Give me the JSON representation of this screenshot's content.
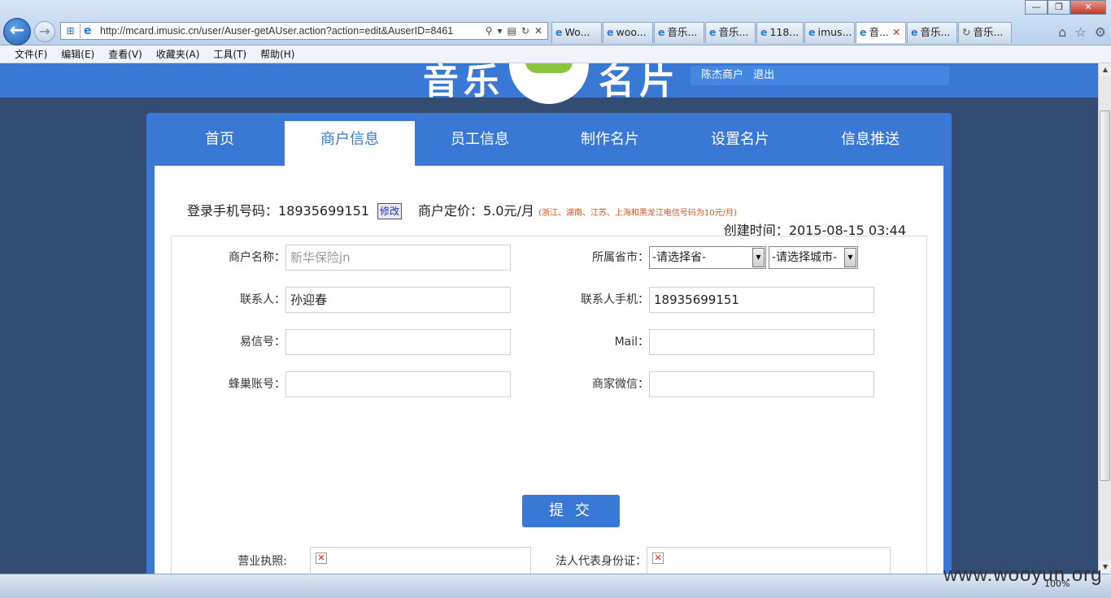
{
  "browser": {
    "url": "http://mcard.imusic.cn/user/Auser-getAUser.action?action=edit&AuserID=8461",
    "tabs": [
      "Wo...",
      "woo...",
      "音乐...",
      "音乐...",
      "118...",
      "imus...",
      "音...",
      "音乐...",
      "音乐..."
    ],
    "active_tab_index": 6,
    "menu": [
      "文件(F)",
      "编辑(E)",
      "查看(V)",
      "收藏夹(A)",
      "工具(T)",
      "帮助(H)"
    ],
    "zoom": "100%",
    "window_buttons": [
      "—",
      "❐",
      "✕"
    ]
  },
  "header": {
    "logo_left": "音乐",
    "logo_right": "名片",
    "user_name": "陈杰商户",
    "logout": "退出"
  },
  "nav": {
    "tabs": [
      "首页",
      "商户信息",
      "员工信息",
      "制作名片",
      "设置名片",
      "信息推送"
    ],
    "active_index": 1
  },
  "info": {
    "login_phone_label": "登录手机号码：",
    "login_phone": "18935699151",
    "edit_label": "修改",
    "price_label": "商户定价：",
    "price": "5.0元/月",
    "price_note": "(浙江、湖南、江苏、上海和黑龙江电信号码为10元/月)",
    "created_label": "创建时间：",
    "created": "2015-08-15 03:44"
  },
  "form": {
    "merchant_name_label": "商户名称：",
    "merchant_name_value": "新华保险jn",
    "region_label": "所属省市：",
    "province_value": "-请选择省-",
    "city_value": "-请选择城市-",
    "contact_label": "联系人：",
    "contact_value": "孙迎春",
    "contact_phone_label": "联系人手机：",
    "contact_phone_value": "18935699151",
    "yixin_label": "易信号：",
    "yixin_value": "",
    "mail_label": "Mail：",
    "mail_value": "",
    "fengchao_label": "蜂巢账号：",
    "fengchao_value": "",
    "wechat_label": "商家微信：",
    "wechat_value": "",
    "submit_label": "提 交",
    "license_label": "营业执照:",
    "legal_id_label": "法人代表身份证："
  },
  "watermark": "www.wooyun.org",
  "colors": {
    "brand_blue": "#3a78d6",
    "page_bg": "#324c74",
    "note_orange": "#d0531a"
  }
}
